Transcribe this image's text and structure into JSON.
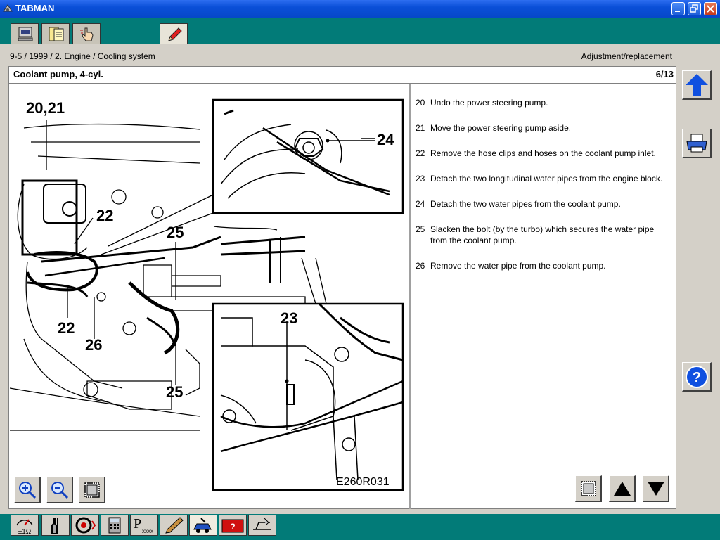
{
  "window": {
    "title": "TABMAN"
  },
  "top_tabs": [
    {
      "icon": "computer-icon"
    },
    {
      "icon": "document-list-icon"
    },
    {
      "icon": "hand-pointer-icon"
    },
    {
      "icon": "pen-icon"
    }
  ],
  "breadcrumb": {
    "path": "9-5 / 1999 / 2. Engine / Cooling system",
    "mode": "Adjustment/replacement"
  },
  "document": {
    "title": "Coolant pump, 4-cyl.",
    "page": "6/13"
  },
  "illustration": {
    "labels": [
      "20,21",
      "22",
      "25",
      "24",
      "22",
      "26",
      "25",
      "23"
    ],
    "ref": "E260R031"
  },
  "steps": [
    {
      "num": "20",
      "text": "Undo the power steering pump."
    },
    {
      "num": "21",
      "text": "Move the power steering pump aside."
    },
    {
      "num": "22",
      "text": "Remove the hose clips and hoses on the coolant pump inlet."
    },
    {
      "num": "23",
      "text": "Detach the two longitudinal water pipes from the engine block."
    },
    {
      "num": "24",
      "text": "Detach the two water pipes from the coolant pump."
    },
    {
      "num": "25",
      "text": "Slacken the bolt (by the turbo) which secures the water pipe from the coolant pump."
    },
    {
      "num": "26",
      "text": "Remove the water pipe from the coolant pump."
    }
  ],
  "bottom_tools": [
    {
      "icon": "multimeter-icon"
    },
    {
      "icon": "wrench-icon"
    },
    {
      "icon": "tire-icon"
    },
    {
      "icon": "calculator-icon"
    },
    {
      "icon": "part-number-icon"
    },
    {
      "icon": "pencil-icon"
    },
    {
      "icon": "car-service-icon"
    },
    {
      "icon": "alert-card-icon"
    },
    {
      "icon": "repair-card-icon"
    }
  ],
  "colors": {
    "background": "#027b78",
    "panel": "#d4d0c8",
    "titlebar": "#0a4fd8",
    "accent": "#1050e0"
  }
}
